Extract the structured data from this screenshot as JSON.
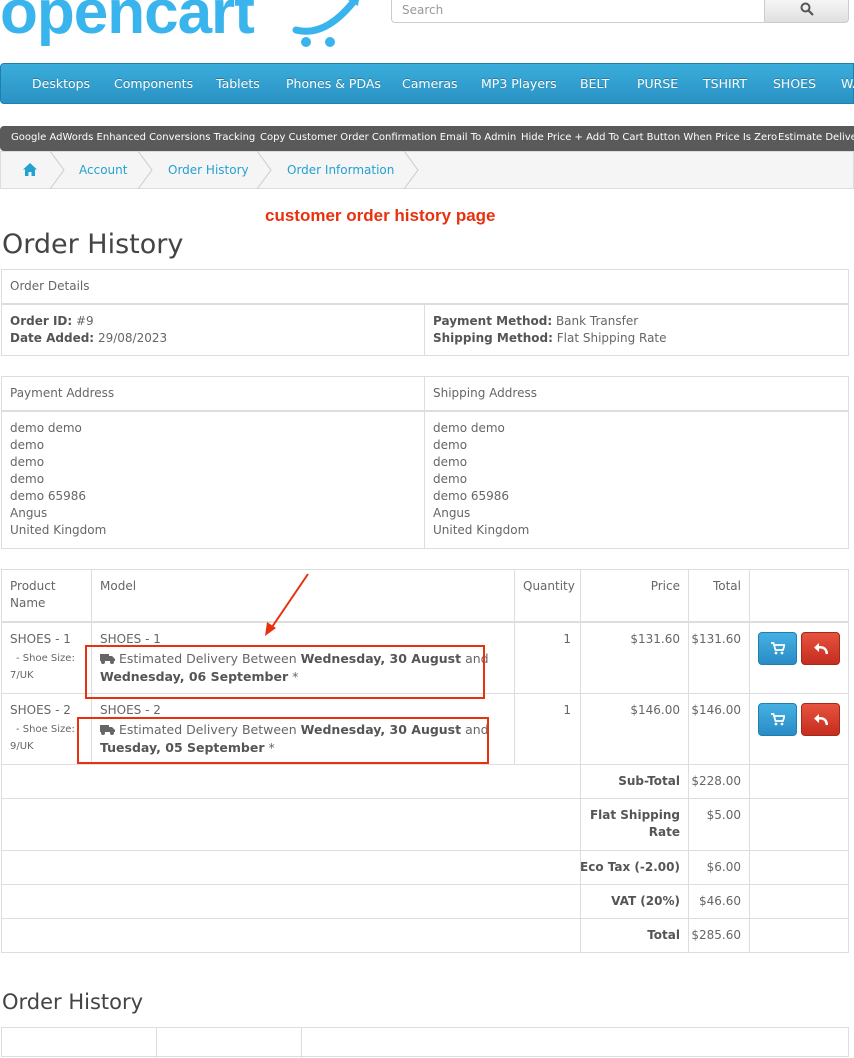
{
  "header": {
    "logo": "opencart",
    "search_placeholder": "Search"
  },
  "menu": [
    "Desktops",
    "Components",
    "Tablets",
    "Phones & PDAs",
    "Cameras",
    "MP3 Players",
    "BELT",
    "PURSE",
    "TSHIRT",
    "SHOES",
    "WA"
  ],
  "extensions": [
    "Google AdWords Enhanced Conversions Tracking",
    "Copy Customer Order Confirmation Email To Admin",
    "Hide Price + Add To Cart Button When Price Is Zero",
    "Estimate Deliver"
  ],
  "breadcrumb": [
    "Account",
    "Order History",
    "Order Information"
  ],
  "annotation": "customer order history page",
  "page_title": "Order History",
  "order_details": {
    "heading": "Order Details",
    "order_id_label": "Order ID:",
    "order_id": "#9",
    "date_added_label": "Date Added:",
    "date_added": "29/08/2023",
    "payment_method_label": "Payment Method:",
    "payment_method": "Bank Transfer",
    "shipping_method_label": "Shipping Method:",
    "shipping_method": "Flat Shipping Rate"
  },
  "addresses": {
    "payment_heading": "Payment Address",
    "shipping_heading": "Shipping Address",
    "payment_lines": [
      "demo demo",
      "demo",
      "demo",
      "demo",
      "demo 65986",
      "Angus",
      "United Kingdom"
    ],
    "shipping_lines": [
      "demo demo",
      "demo",
      "demo",
      "demo",
      "demo 65986",
      "Angus",
      "United Kingdom"
    ]
  },
  "products": {
    "headers": {
      "name_1": "Product",
      "name_2": "Name",
      "model": "Model",
      "quantity": "Quantity",
      "price": "Price",
      "total": "Total"
    },
    "rows": [
      {
        "name": "SHOES - 1",
        "option": "- Shoe Size:",
        "option_value": "7/UK",
        "model": "SHOES - 1",
        "delivery_prefix": "Estimated Delivery Between",
        "delivery_from": "Wednesday, 30 August",
        "delivery_and": "and",
        "delivery_to": "Wednesday, 06 September",
        "quantity": "1",
        "price": "$131.60",
        "total": "$131.60"
      },
      {
        "name": "SHOES - 2",
        "option": "- Shoe Size:",
        "option_value": "9/UK",
        "model": "SHOES - 2",
        "delivery_prefix": "Estimated Delivery Between",
        "delivery_from": "Wednesday, 30 August",
        "delivery_and": "and",
        "delivery_to": "Tuesday, 05 September",
        "quantity": "1",
        "price": "$146.00",
        "total": "$146.00"
      }
    ]
  },
  "totals": [
    {
      "label": "Sub-Total",
      "value": "$228.00"
    },
    {
      "label_1": "Flat Shipping",
      "label_2": "Rate",
      "value": "$5.00"
    },
    {
      "label": "Eco Tax (-2.00)",
      "value": "$6.00"
    },
    {
      "label": "VAT (20%)",
      "value": "$46.60"
    },
    {
      "label": "Total",
      "value": "$285.60"
    }
  ],
  "history_title": "Order History",
  "colors": {
    "accent": "#23a1d1",
    "menu": "#2d9ad0",
    "annotation": "#e8310d",
    "cart_button": "#2a8cc5",
    "return_button": "#c52d20"
  }
}
